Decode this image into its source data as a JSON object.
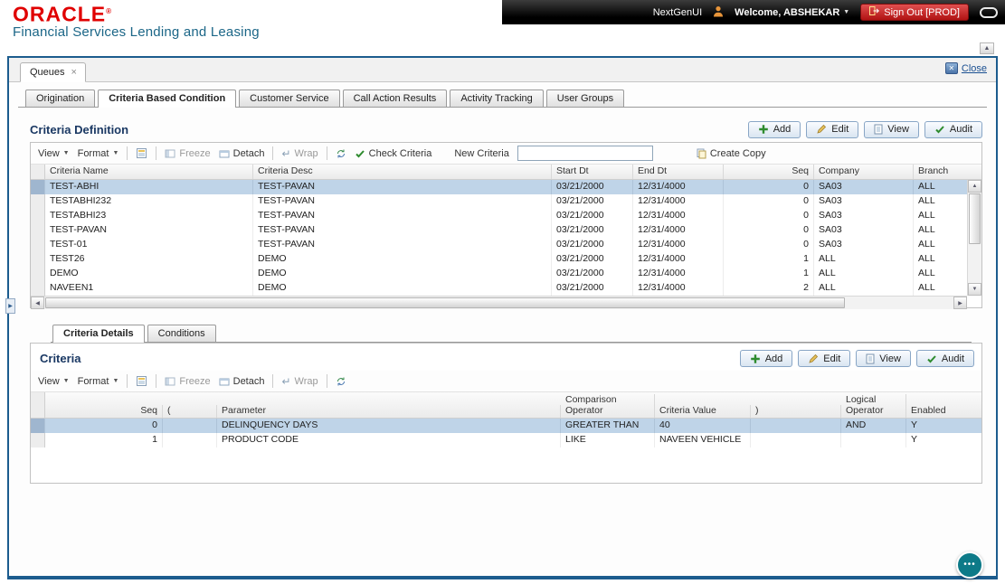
{
  "header": {
    "logo": "ORACLE",
    "registered": "®",
    "subtitle": "Financial Services Lending and Leasing",
    "nextgen_label": "NextGenUI",
    "welcome_label": "Welcome, ABSHEKAR",
    "signout_label": "Sign Out [PROD]"
  },
  "window": {
    "tab_label": "Queues",
    "tab_close": "×",
    "close_label": "Close"
  },
  "tabs": [
    {
      "label": "Origination",
      "active": false
    },
    {
      "label": "Criteria Based Condition",
      "active": true
    },
    {
      "label": "Customer Service",
      "active": false
    },
    {
      "label": "Call Action Results",
      "active": false
    },
    {
      "label": "Activity Tracking",
      "active": false
    },
    {
      "label": "User Groups",
      "active": false
    }
  ],
  "criteria_definition": {
    "title": "Criteria Definition",
    "actions": [
      {
        "label": "Add",
        "icon": "plus"
      },
      {
        "label": "Edit",
        "icon": "pencil"
      },
      {
        "label": "View",
        "icon": "doc"
      },
      {
        "label": "Audit",
        "icon": "check"
      }
    ],
    "toolbar": {
      "view": "View",
      "format": "Format",
      "freeze": "Freeze",
      "detach": "Detach",
      "wrap": "Wrap",
      "check_criteria": "Check Criteria",
      "new_criteria_label": "New Criteria",
      "new_criteria_value": "",
      "create_copy": "Create Copy"
    },
    "columns": [
      "Criteria Name",
      "Criteria Desc",
      "Start Dt",
      "End Dt",
      "Seq",
      "Company",
      "Branch"
    ],
    "rows": [
      [
        "TEST-ABHI",
        "TEST-PAVAN",
        "03/21/2000",
        "12/31/4000",
        "0",
        "SA03",
        "ALL"
      ],
      [
        "TESTABHI232",
        "TEST-PAVAN",
        "03/21/2000",
        "12/31/4000",
        "0",
        "SA03",
        "ALL"
      ],
      [
        "TESTABHI23",
        "TEST-PAVAN",
        "03/21/2000",
        "12/31/4000",
        "0",
        "SA03",
        "ALL"
      ],
      [
        "TEST-PAVAN",
        "TEST-PAVAN",
        "03/21/2000",
        "12/31/4000",
        "0",
        "SA03",
        "ALL"
      ],
      [
        "TEST-01",
        "TEST-PAVAN",
        "03/21/2000",
        "12/31/4000",
        "0",
        "SA03",
        "ALL"
      ],
      [
        "TEST26",
        "DEMO",
        "03/21/2000",
        "12/31/4000",
        "1",
        "ALL",
        "ALL"
      ],
      [
        "DEMO",
        "DEMO",
        "03/21/2000",
        "12/31/4000",
        "1",
        "ALL",
        "ALL"
      ],
      [
        "NAVEEN1",
        "DEMO",
        "03/21/2000",
        "12/31/4000",
        "2",
        "ALL",
        "ALL"
      ]
    ],
    "selected_row": 0
  },
  "detail_tabs": [
    {
      "label": "Criteria Details",
      "active": true
    },
    {
      "label": "Conditions",
      "active": false
    }
  ],
  "criteria": {
    "title": "Criteria",
    "actions": [
      {
        "label": "Add",
        "icon": "plus"
      },
      {
        "label": "Edit",
        "icon": "pencil"
      },
      {
        "label": "View",
        "icon": "doc"
      },
      {
        "label": "Audit",
        "icon": "check"
      }
    ],
    "toolbar": {
      "view": "View",
      "format": "Format",
      "freeze": "Freeze",
      "detach": "Detach",
      "wrap": "Wrap"
    },
    "columns": [
      "Seq",
      "(",
      "Parameter",
      "Comparison Operator",
      "Criteria Value",
      ")",
      "Logical Operator",
      "Enabled"
    ],
    "rows": [
      [
        "0",
        "",
        "DELINQUENCY DAYS",
        "GREATER THAN",
        "40",
        "",
        "AND",
        "Y"
      ],
      [
        "1",
        "",
        "PRODUCT CODE",
        "LIKE",
        "NAVEEN VEHICLE",
        "",
        "",
        "Y"
      ]
    ],
    "selected_row": 0
  },
  "colors": {
    "oracle_red": "#e00000",
    "subtitle_blue": "#1b6687",
    "frame_border": "#1c5c8e",
    "selected_row": "#bfd4e8",
    "signout_red": "#b01212",
    "heading_navy": "#1a3863",
    "fab_teal": "#0d7a88"
  }
}
